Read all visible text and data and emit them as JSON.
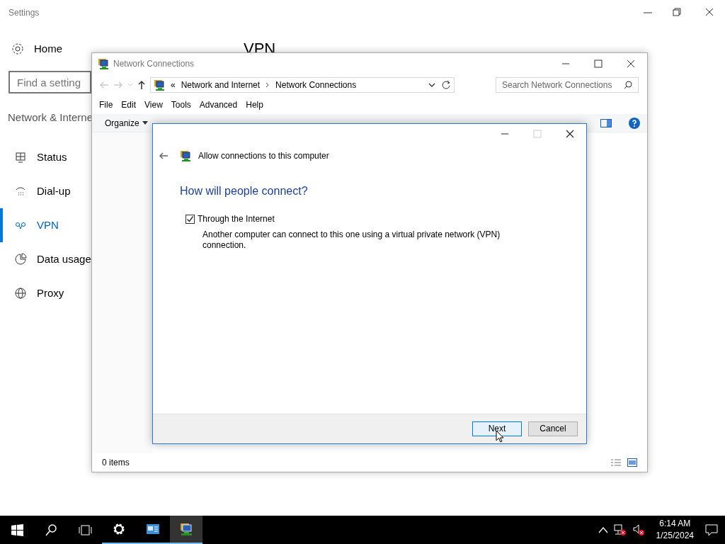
{
  "settings": {
    "title": "Settings",
    "home": "Home",
    "search_placeholder": "Find a setting",
    "section": "Network & Interne",
    "page_title": "VPN",
    "nav": [
      {
        "label": "Status",
        "kind": "status",
        "selected": false
      },
      {
        "label": "Dial-up",
        "kind": "dialup",
        "selected": false
      },
      {
        "label": "VPN",
        "kind": "vpn",
        "selected": true
      },
      {
        "label": "Data usage",
        "kind": "data",
        "selected": false
      },
      {
        "label": "Proxy",
        "kind": "proxy",
        "selected": false
      }
    ]
  },
  "explorer": {
    "title": "Network Connections",
    "overflow": "«",
    "breadcrumb": [
      "Network and Internet",
      "Network Connections"
    ],
    "search_placeholder": "Search Network Connections",
    "menu": [
      "File",
      "Edit",
      "View",
      "Tools",
      "Advanced",
      "Help"
    ],
    "organize": "Organize",
    "status": "0 items"
  },
  "dialog": {
    "title": "Allow connections to this computer",
    "heading": "How will people connect?",
    "options": [
      {
        "label": "Through the Internet",
        "description": "Another computer can connect to this one using a virtual private network (VPN) connection.",
        "checked": true
      }
    ],
    "buttons": [
      {
        "label": "Next",
        "kind": "default"
      },
      {
        "label": "Cancel",
        "kind": "normal"
      }
    ]
  },
  "taskbar": {
    "apps": [
      {
        "kind": "settings",
        "running": true,
        "active": false
      },
      {
        "kind": "control",
        "running": true,
        "active": false
      },
      {
        "kind": "network",
        "running": true,
        "active": true
      }
    ],
    "time": "6:14 AM",
    "date": "1/25/2024"
  }
}
